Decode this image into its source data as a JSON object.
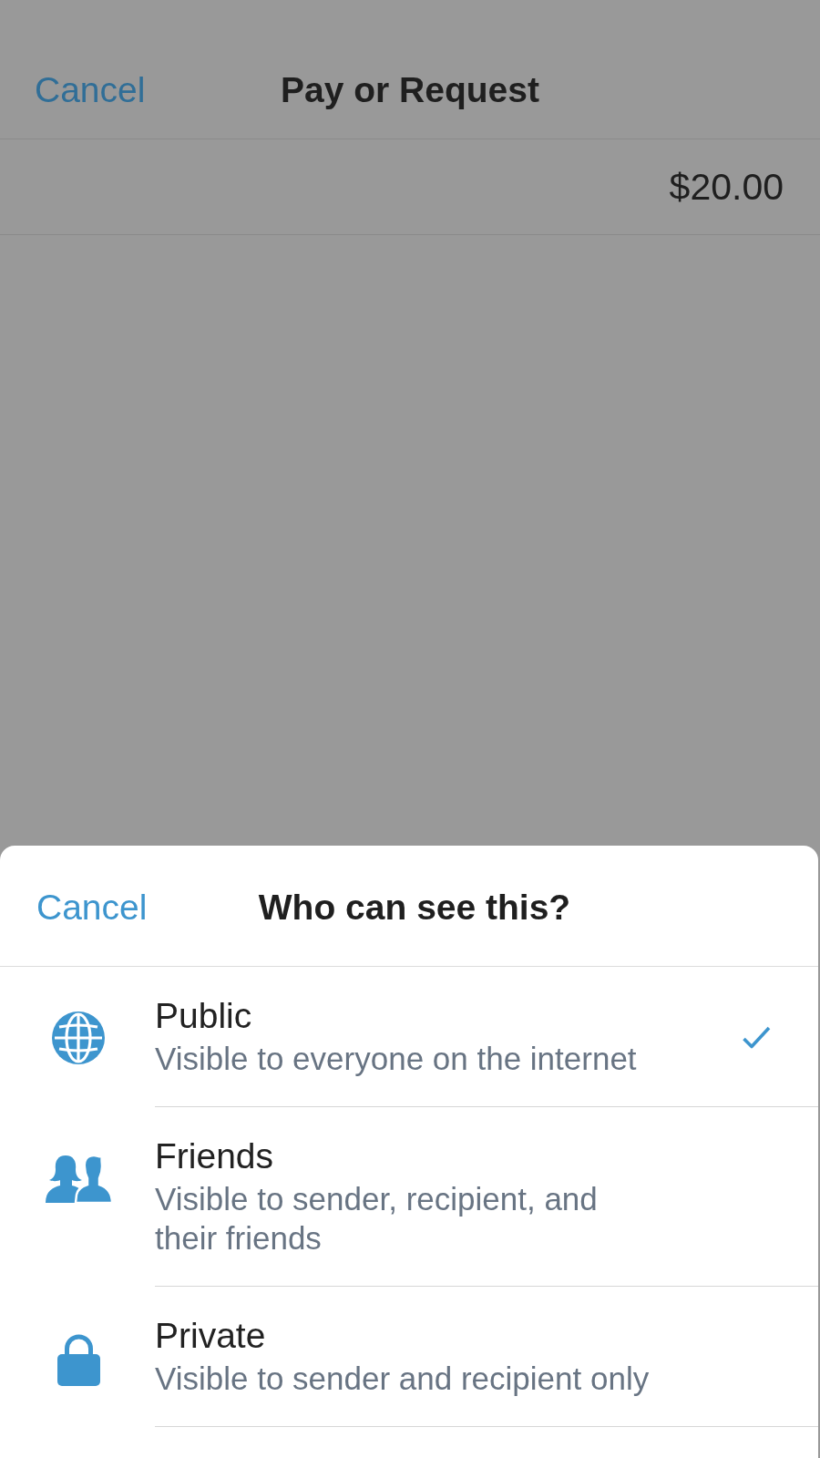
{
  "background": {
    "nav_bar": {
      "cancel": "Cancel",
      "title": "Pay or Request"
    },
    "amount": "$20.00"
  },
  "sheet": {
    "cancel": "Cancel",
    "title": "Who can see this?",
    "options": [
      {
        "kind": "globe",
        "title": "Public",
        "description": "Visible to everyone on the internet",
        "selected": true
      },
      {
        "kind": "friends",
        "title": "Friends",
        "description": "Visible to sender, recipient, and their friends",
        "selected": false
      },
      {
        "kind": "lock",
        "title": "Private",
        "description": "Visible to sender and recipient only",
        "selected": false
      }
    ]
  }
}
